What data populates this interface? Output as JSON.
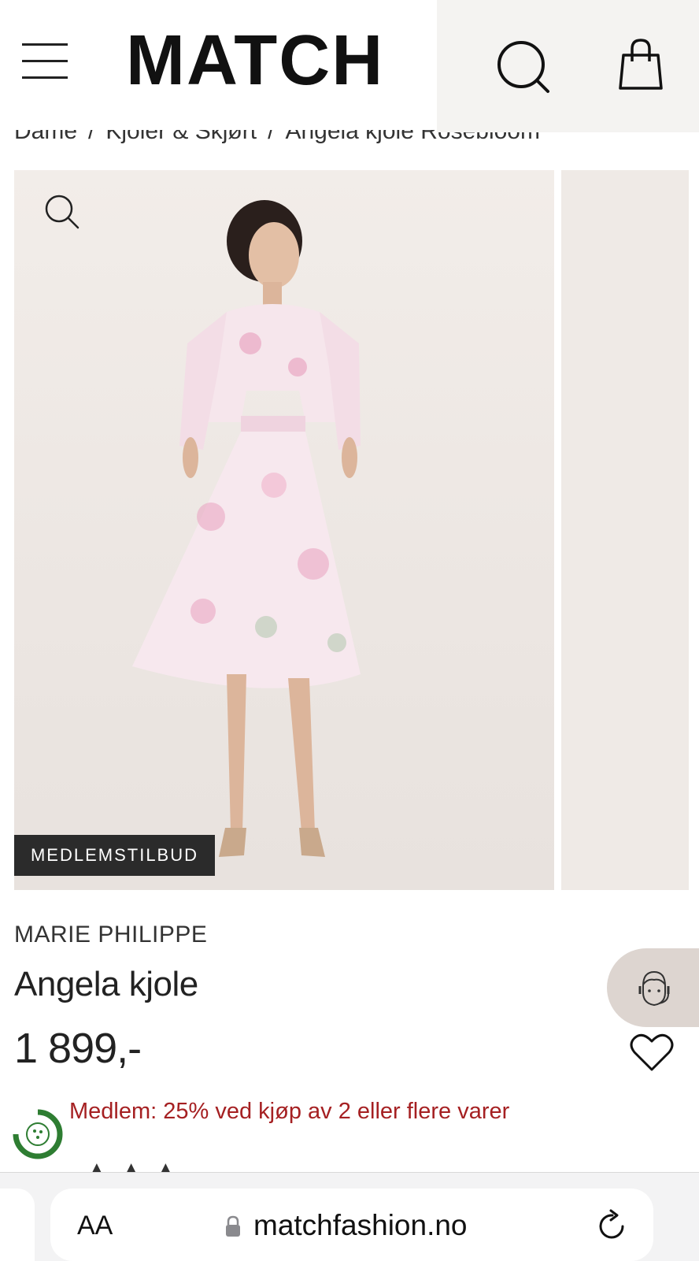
{
  "header": {
    "logo": "MATCH"
  },
  "breadcrumb": {
    "items": [
      "Dame",
      "Kjoler & Skjørt",
      "Angela kjole Rosebloom"
    ],
    "separator": "/"
  },
  "gallery": {
    "badge": "MEDLEMSTILBUD"
  },
  "product": {
    "brand": "MARIE PHILIPPE",
    "name": "Angela kjole",
    "price": "1 899,-",
    "promo": "Medlem: 25% ved kjøp av 2 eller flere varer"
  },
  "browser": {
    "text_size_label": "AA",
    "url": "matchfashion.no"
  },
  "colors": {
    "promo": "#a52022",
    "badge_bg": "#2b2b2b",
    "header_right_bg": "#f4f3f1",
    "chat_bg": "#ddd5d0",
    "eco_green": "#2e7d32"
  }
}
